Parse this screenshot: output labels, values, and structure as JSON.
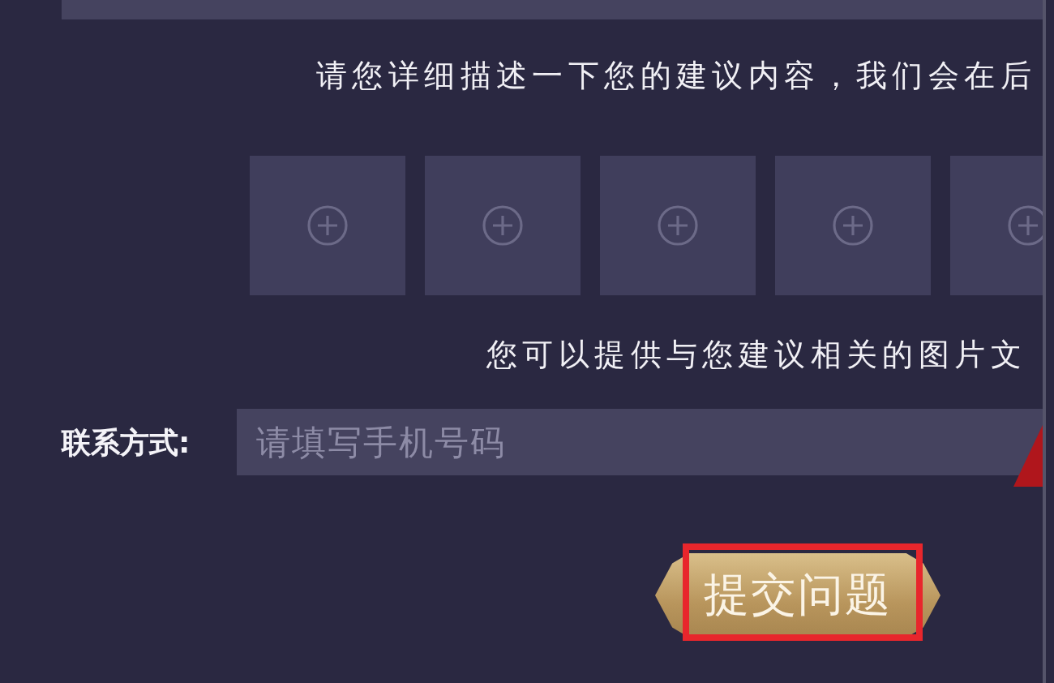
{
  "description": {
    "hint": "请您详细描述一下您的建议内容，我们会在后"
  },
  "uploads": {
    "slots": [
      {
        "kind": "add"
      },
      {
        "kind": "add"
      },
      {
        "kind": "add"
      },
      {
        "kind": "add"
      },
      {
        "kind": "add"
      }
    ],
    "hint": "您可以提供与您建议相关的图片文"
  },
  "contact": {
    "label": "联系方式:",
    "placeholder": "请填写手机号码"
  },
  "submit": {
    "label": "提交问题",
    "highlighted": true
  }
}
